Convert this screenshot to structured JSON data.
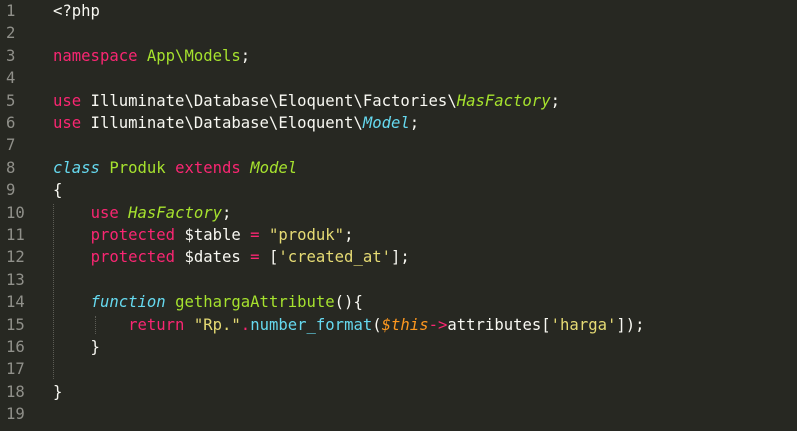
{
  "editor": {
    "language": "php",
    "lines": [
      {
        "num": "1",
        "segments": [
          {
            "t": "<?php",
            "c": "wht"
          }
        ]
      },
      {
        "num": "2",
        "segments": []
      },
      {
        "num": "3",
        "segments": [
          {
            "t": "namespace",
            "c": "kw"
          },
          {
            "t": " ",
            "c": "wht"
          },
          {
            "t": "App\\Models",
            "c": "cls"
          },
          {
            "t": ";",
            "c": "wht"
          }
        ]
      },
      {
        "num": "4",
        "segments": []
      },
      {
        "num": "5",
        "segments": [
          {
            "t": "use",
            "c": "kw"
          },
          {
            "t": " Illuminate\\Database\\Eloquent\\Factories\\",
            "c": "wht"
          },
          {
            "t": "HasFactory",
            "c": "clsi"
          },
          {
            "t": ";",
            "c": "wht"
          }
        ]
      },
      {
        "num": "6",
        "segments": [
          {
            "t": "use",
            "c": "kw"
          },
          {
            "t": " Illuminate\\Database\\Eloquent\\",
            "c": "wht"
          },
          {
            "t": "Model",
            "c": "it"
          },
          {
            "t": ";",
            "c": "wht"
          }
        ]
      },
      {
        "num": "7",
        "segments": []
      },
      {
        "num": "8",
        "segments": [
          {
            "t": "class",
            "c": "it"
          },
          {
            "t": " ",
            "c": "wht"
          },
          {
            "t": "Produk",
            "c": "cls"
          },
          {
            "t": " ",
            "c": "wht"
          },
          {
            "t": "extends",
            "c": "kw"
          },
          {
            "t": " ",
            "c": "wht"
          },
          {
            "t": "Model",
            "c": "clsi"
          }
        ]
      },
      {
        "num": "9",
        "segments": [
          {
            "t": "{",
            "c": "wht"
          }
        ]
      },
      {
        "num": "10",
        "segments": [
          {
            "t": "    ",
            "c": "wht"
          },
          {
            "t": "use",
            "c": "kw"
          },
          {
            "t": " ",
            "c": "wht"
          },
          {
            "t": "HasFactory",
            "c": "clsi"
          },
          {
            "t": ";",
            "c": "wht"
          }
        ]
      },
      {
        "num": "11",
        "segments": [
          {
            "t": "    ",
            "c": "wht"
          },
          {
            "t": "protected",
            "c": "kw"
          },
          {
            "t": " $table ",
            "c": "wht"
          },
          {
            "t": "=",
            "c": "kw"
          },
          {
            "t": " ",
            "c": "wht"
          },
          {
            "t": "\"produk\"",
            "c": "str"
          },
          {
            "t": ";",
            "c": "wht"
          }
        ]
      },
      {
        "num": "12",
        "segments": [
          {
            "t": "    ",
            "c": "wht"
          },
          {
            "t": "protected",
            "c": "kw"
          },
          {
            "t": " $dates ",
            "c": "wht"
          },
          {
            "t": "=",
            "c": "kw"
          },
          {
            "t": " [",
            "c": "wht"
          },
          {
            "t": "'created_at'",
            "c": "str"
          },
          {
            "t": "];",
            "c": "wht"
          }
        ]
      },
      {
        "num": "13",
        "segments": []
      },
      {
        "num": "14",
        "segments": [
          {
            "t": "    ",
            "c": "wht"
          },
          {
            "t": "function",
            "c": "it"
          },
          {
            "t": " ",
            "c": "wht"
          },
          {
            "t": "gethargaAttribute",
            "c": "cls"
          },
          {
            "t": "(){",
            "c": "wht"
          }
        ]
      },
      {
        "num": "15",
        "segments": [
          {
            "t": "        ",
            "c": "wht"
          },
          {
            "t": "return",
            "c": "kw"
          },
          {
            "t": " ",
            "c": "wht"
          },
          {
            "t": "\"Rp.\"",
            "c": "str"
          },
          {
            "t": ".",
            "c": "kw"
          },
          {
            "t": "number_format",
            "c": "fn"
          },
          {
            "t": "(",
            "c": "wht"
          },
          {
            "t": "$this",
            "c": "var"
          },
          {
            "t": "->",
            "c": "kw"
          },
          {
            "t": "attributes[",
            "c": "wht"
          },
          {
            "t": "'harga'",
            "c": "str"
          },
          {
            "t": "]);",
            "c": "wht"
          }
        ]
      },
      {
        "num": "16",
        "segments": [
          {
            "t": "    }",
            "c": "wht"
          }
        ]
      },
      {
        "num": "17",
        "segments": []
      },
      {
        "num": "18",
        "segments": [
          {
            "t": "}",
            "c": "wht"
          }
        ]
      },
      {
        "num": "19",
        "segments": []
      }
    ]
  },
  "colors": {
    "background": "#272822",
    "current_line": "#3e3d32",
    "gutter_text": "#90908a",
    "keyword": "#f92672",
    "storage_italic": "#66d9ef",
    "class_name": "#a6e22e",
    "string": "#e6db74",
    "variable_this": "#fd971f",
    "text": "#f8f8f2"
  },
  "current_line": "17"
}
